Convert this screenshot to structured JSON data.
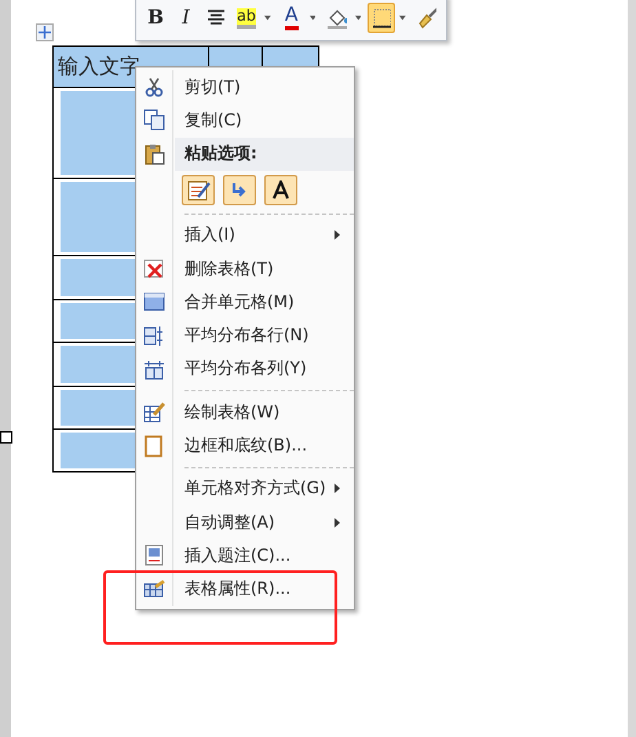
{
  "toolbar": {
    "buttons": [
      {
        "kind": "bold",
        "label": "B",
        "dropdown": false,
        "selected": false
      },
      {
        "kind": "italic",
        "label": "I",
        "dropdown": false,
        "selected": false
      },
      {
        "kind": "center",
        "dropdown": false,
        "selected": false
      },
      {
        "kind": "highlight",
        "label": "ab",
        "dropdown": true,
        "selected": false
      },
      {
        "kind": "fontcolor",
        "label": "A",
        "dropdown": true,
        "selected": false
      },
      {
        "kind": "shading",
        "dropdown": true,
        "selected": false
      },
      {
        "kind": "borders",
        "dropdown": true,
        "selected": true
      },
      {
        "kind": "painter",
        "dropdown": false,
        "selected": false
      }
    ]
  },
  "table": {
    "columns": [
      "输入文字"
    ],
    "rows": [
      {
        "selected": true
      },
      {
        "selected": true
      },
      {
        "selected": true
      },
      {
        "selected": true
      },
      {
        "selected": true
      },
      {
        "selected": true
      },
      {
        "selected": true
      }
    ]
  },
  "context_menu": {
    "items": [
      {
        "kind": "item",
        "label": "剪切(T)",
        "submenu": false
      },
      {
        "kind": "item",
        "label": "复制(C)",
        "submenu": false
      },
      {
        "kind": "header",
        "label": "粘贴选项:"
      },
      {
        "kind": "paste"
      },
      {
        "kind": "separator"
      },
      {
        "kind": "item",
        "label": "插入(I)",
        "submenu": true
      },
      {
        "kind": "item",
        "label": "删除表格(T)",
        "submenu": false
      },
      {
        "kind": "item",
        "label": "合并单元格(M)",
        "submenu": false
      },
      {
        "kind": "item",
        "label": "平均分布各行(N)",
        "submenu": false
      },
      {
        "kind": "item",
        "label": "平均分布各列(Y)",
        "submenu": false
      },
      {
        "kind": "separator"
      },
      {
        "kind": "item",
        "label": "绘制表格(W)",
        "submenu": false
      },
      {
        "kind": "item",
        "label": "边框和底纹(B)...",
        "submenu": false
      },
      {
        "kind": "separator"
      },
      {
        "kind": "item",
        "label": "单元格对齐方式(G)",
        "submenu": true
      },
      {
        "kind": "item",
        "label": "自动调整(A)",
        "submenu": true
      },
      {
        "kind": "item",
        "label": "插入题注(C)...",
        "submenu": false
      },
      {
        "kind": "item",
        "label": "表格属性(R)...",
        "submenu": false,
        "highlighted": true
      }
    ]
  }
}
